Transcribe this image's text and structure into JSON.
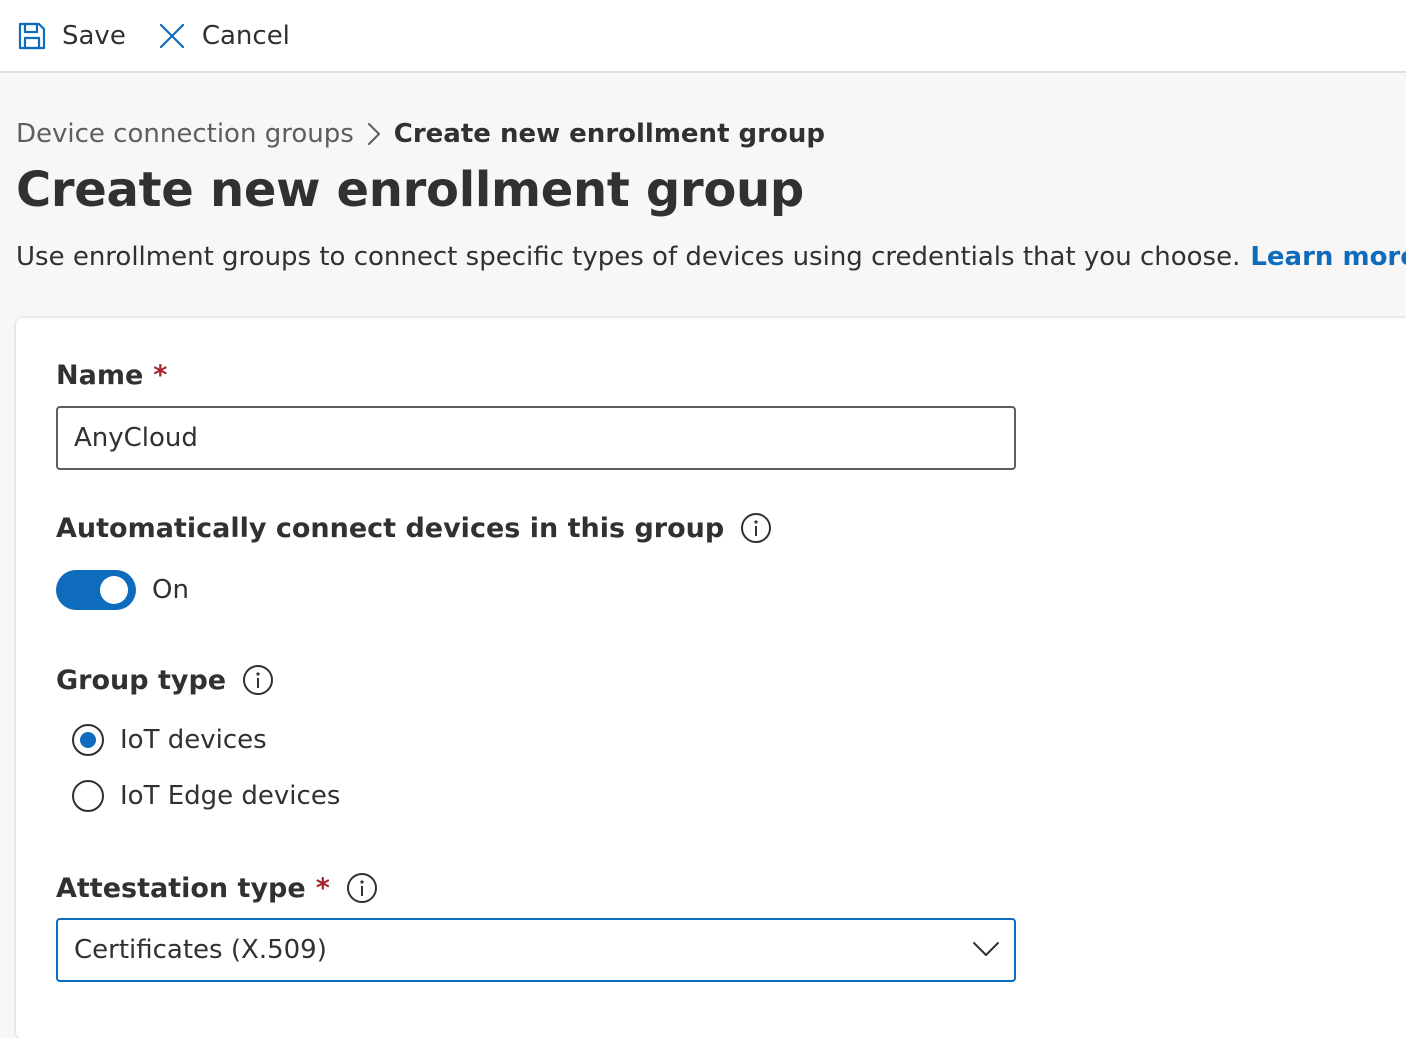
{
  "toolbar": {
    "save_label": "Save",
    "cancel_label": "Cancel"
  },
  "breadcrumb": {
    "parent": "Device connection groups",
    "current": "Create new enrollment group"
  },
  "page": {
    "title": "Create new enrollment group",
    "description": "Use enrollment groups to connect specific types of devices using credentials that you choose.",
    "learn_more": "Learn more"
  },
  "form": {
    "name": {
      "label": "Name",
      "required": "*",
      "value": "AnyCloud"
    },
    "auto_connect": {
      "label": "Automatically connect devices in this group",
      "state_label": "On",
      "enabled": true
    },
    "group_type": {
      "label": "Group type",
      "options": [
        {
          "label": "IoT devices",
          "selected": true
        },
        {
          "label": "IoT Edge devices",
          "selected": false
        }
      ]
    },
    "attestation_type": {
      "label": "Attestation type",
      "required": "*",
      "selected": "Certificates (X.509)"
    }
  },
  "colors": {
    "accent": "#0f6cbd",
    "required": "#a4262c",
    "background": "#f8f7f6"
  }
}
